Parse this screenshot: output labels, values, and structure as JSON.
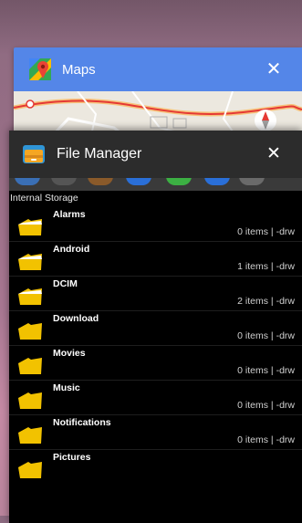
{
  "maps_card": {
    "title": "Maps",
    "icon": "maps-logo-icon",
    "close_icon": "close-icon",
    "color": "#5486e8"
  },
  "file_manager_card": {
    "title": "File Manager",
    "icon": "file-manager-icon",
    "close_icon": "close-icon",
    "location": "Internal Storage",
    "items": [
      {
        "name": "Alarms",
        "meta": "0 items | -drw"
      },
      {
        "name": "Android",
        "meta": "1 items | -drw"
      },
      {
        "name": "DCIM",
        "meta": "2 items | -drw"
      },
      {
        "name": "Download",
        "meta": "0 items | -drw"
      },
      {
        "name": "Movies",
        "meta": "0 items | -drw"
      },
      {
        "name": "Music",
        "meta": "0 items | -drw"
      },
      {
        "name": "Notifications",
        "meta": "0 items | -drw"
      },
      {
        "name": "Pictures",
        "meta": ""
      }
    ]
  }
}
